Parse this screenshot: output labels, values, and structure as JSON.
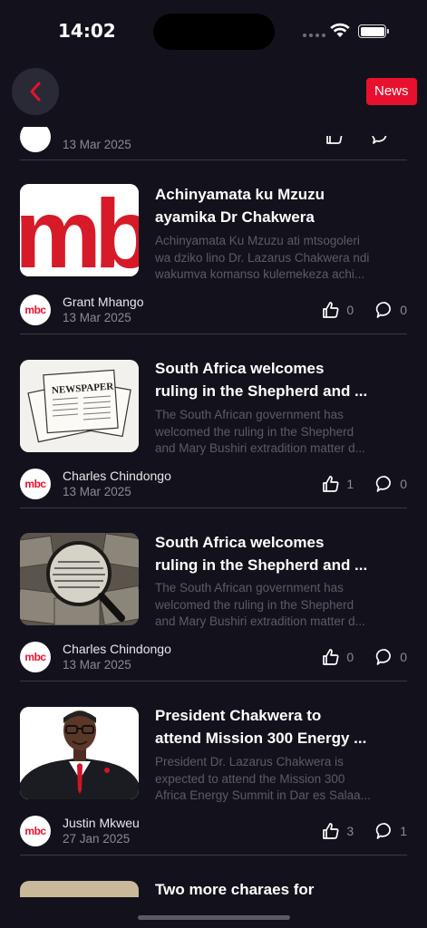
{
  "status": {
    "time": "14:02"
  },
  "header": {
    "badge": "News"
  },
  "partial_top": {
    "date": "13 Mar 2025"
  },
  "articles": [
    {
      "title_lines": [
        "Achinyamata ku Mzuzu",
        "ayamika Dr Chakwera"
      ],
      "excerpt_lines": [
        "Achinyamata Ku Mzuzu ati mtsogoleri",
        "wa dziko lino Dr. Lazarus Chakwera ndi",
        "wakumva komanso kulemekeza achi..."
      ],
      "author": "Grant Mhango",
      "date": "13 Mar 2025",
      "likes": "0",
      "comments": "0",
      "thumb_text": "mbc"
    },
    {
      "title_lines": [
        "South Africa welcomes",
        "ruling in the Shepherd and ..."
      ],
      "excerpt_lines": [
        "The South African government has",
        "welcomed the ruling in the Shepherd",
        "and Mary Bushiri extradition matter d..."
      ],
      "author": "Charles Chindongo",
      "date": "13 Mar 2025",
      "likes": "1",
      "comments": "0",
      "thumb_text": "NEWSPAPER"
    },
    {
      "title_lines": [
        "South Africa welcomes",
        "ruling in the Shepherd and ..."
      ],
      "excerpt_lines": [
        "The South African government has",
        "welcomed the ruling in the Shepherd",
        "and Mary Bushiri extradition matter d..."
      ],
      "author": "Charles Chindongo",
      "date": "13 Mar 2025",
      "likes": "0",
      "comments": "0"
    },
    {
      "title_lines": [
        "President Chakwera to",
        "attend Mission 300 Energy ..."
      ],
      "excerpt_lines": [
        "President Dr. Lazarus Chakwera is",
        "expected to attend the Mission 300",
        "Africa Energy Summit in Dar es Salaa..."
      ],
      "author": "Justin Mkweu",
      "date": "27 Jan 2025",
      "likes": "3",
      "comments": "1"
    },
    {
      "title_lines": [
        "Two more charaes for"
      ]
    }
  ],
  "avatar_text": "mbc",
  "colors": {
    "accent": "#e8112d",
    "background": "#13121c",
    "muted": "#5b5b66"
  }
}
